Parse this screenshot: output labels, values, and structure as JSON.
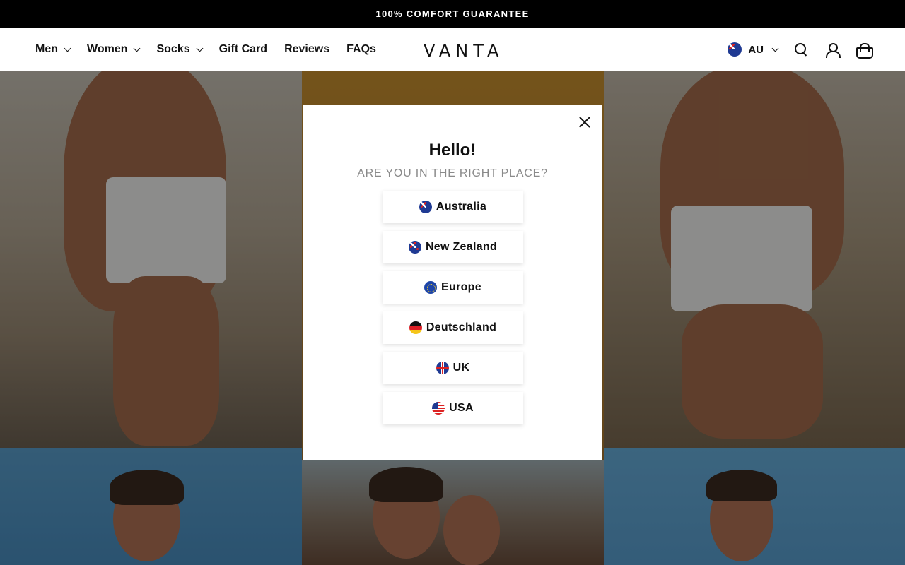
{
  "announcement": {
    "text": "100% COMFORT GUARANTEE"
  },
  "header": {
    "nav": [
      {
        "label": "Men",
        "has_dropdown": true
      },
      {
        "label": "Women",
        "has_dropdown": true
      },
      {
        "label": "Socks",
        "has_dropdown": true
      },
      {
        "label": "Gift Card",
        "has_dropdown": false
      },
      {
        "label": "Reviews",
        "has_dropdown": false
      },
      {
        "label": "FAQs",
        "has_dropdown": false
      }
    ],
    "logo": "VANTA",
    "locale": {
      "code": "AU",
      "flag": "australia-flag-icon"
    },
    "icons": [
      "search-icon",
      "account-icon",
      "cart-icon"
    ]
  },
  "modal": {
    "title": "Hello!",
    "subtitle": "ARE YOU IN THE RIGHT PLACE?",
    "regions": [
      {
        "label": "Australia",
        "flag": "australia-flag-icon"
      },
      {
        "label": "New Zealand",
        "flag": "new-zealand-flag-icon"
      },
      {
        "label": "Europe",
        "flag": "eu-flag-icon"
      },
      {
        "label": "Deutschland",
        "flag": "germany-flag-icon"
      },
      {
        "label": "UK",
        "flag": "uk-flag-icon"
      },
      {
        "label": "USA",
        "flag": "usa-flag-icon"
      }
    ]
  },
  "colors": {
    "announcement_bg": "#000000",
    "overlay": "rgba(0,0,0,0.42)",
    "modal_bg": "#ffffff",
    "subtitle": "#8a8a8a"
  }
}
